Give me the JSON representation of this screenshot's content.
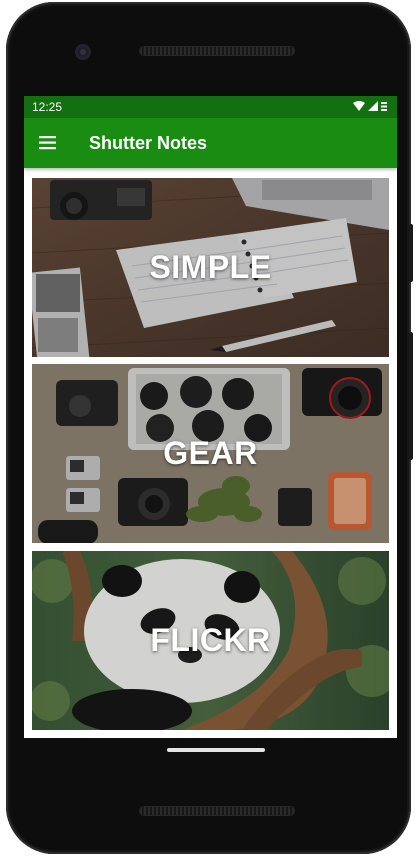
{
  "status_bar": {
    "time": "12:25"
  },
  "app_bar": {
    "title": "Shutter Notes"
  },
  "cards": [
    {
      "label": "SIMPLE"
    },
    {
      "label": "GEAR"
    },
    {
      "label": "FLICKR"
    }
  ],
  "colors": {
    "status_bar": "#127010",
    "app_bar": "#198c12",
    "card_text": "#ffffff"
  },
  "icons": [
    "menu-icon",
    "wifi-icon",
    "signal-icon",
    "battery-icon"
  ]
}
